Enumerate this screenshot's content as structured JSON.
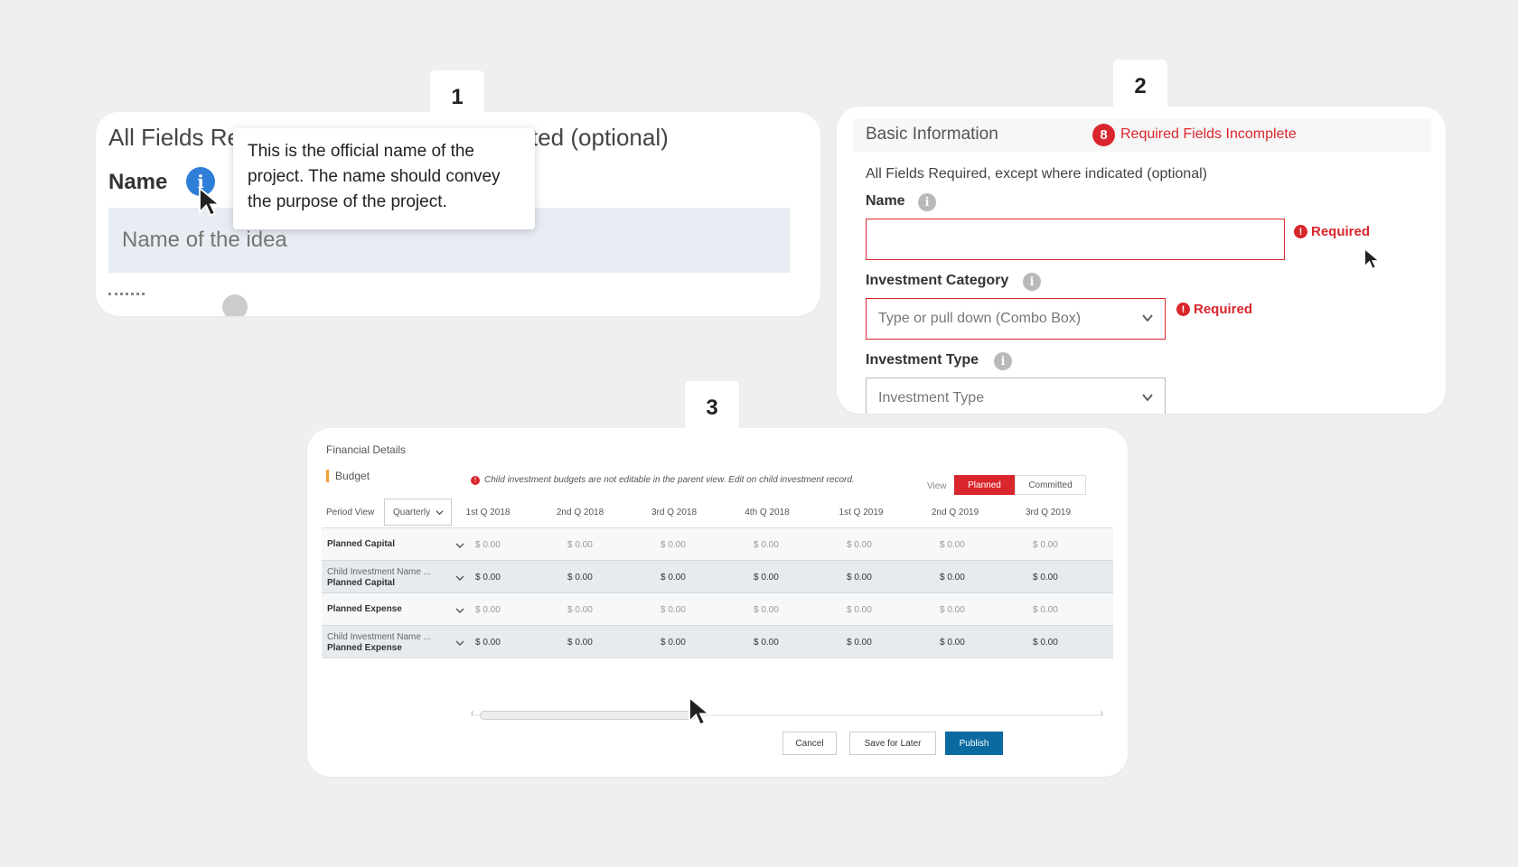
{
  "step_badges": [
    "1",
    "2",
    "3"
  ],
  "card1": {
    "heading_left": "All Fields Re",
    "heading_right": "ted (optional)",
    "name_label": "Name",
    "info_icon": "info-icon",
    "input_placeholder": "Name of the idea",
    "tooltip_lines": [
      "This is the official name of the",
      "project. The name should convey",
      "the purpose of the project."
    ]
  },
  "card2": {
    "header_title": "Basic Information",
    "error_count": "8",
    "error_text": "Required Fields Incomplete",
    "required_note": "All Fields Required, except where indicated (optional)",
    "name_label": "Name",
    "required_label": "Required",
    "investment_category_label": "Investment Category",
    "investment_category_placeholder": "Type or pull down (Combo Box)",
    "investment_type_label": "Investment Type",
    "investment_type_placeholder": "Investment Type",
    "error_color": "#d9262c"
  },
  "card3": {
    "title": "Financial Details",
    "budget_label": "Budget",
    "notice": "Child investment budgets are not editable in the parent view. Edit on child investment record.",
    "view_label": "View",
    "view_options": [
      "Planned",
      "Committed"
    ],
    "view_selected": "Planned",
    "period_view_label": "Period View",
    "period_view_value": "Quarterly",
    "columns": [
      "1st Q 2018",
      "2nd Q 2018",
      "3rd Q 2018",
      "4th Q 2018",
      "1st Q 2019",
      "2nd Q 2019",
      "3rd Q 2019"
    ],
    "rows": [
      {
        "label": "Planned Capital",
        "sub": "",
        "kind": "parent",
        "values": [
          "$ 0.00",
          "$ 0.00",
          "$ 0.00",
          "$ 0.00",
          "$ 0.00",
          "$ 0.00",
          "$ 0.00"
        ]
      },
      {
        "label": "Planned Capital",
        "sub": "Child Investment Name ...",
        "kind": "child",
        "values": [
          "$ 0.00",
          "$ 0.00",
          "$ 0.00",
          "$ 0.00",
          "$ 0.00",
          "$ 0.00",
          "$ 0.00"
        ]
      },
      {
        "label": "Planned Expense",
        "sub": "",
        "kind": "parent",
        "values": [
          "$ 0.00",
          "$ 0.00",
          "$ 0.00",
          "$ 0.00",
          "$ 0.00",
          "$ 0.00",
          "$ 0.00"
        ]
      },
      {
        "label": "Planned Expense",
        "sub": "Child Investment Name ...",
        "kind": "child",
        "values": [
          "$ 0.00",
          "$ 0.00",
          "$ 0.00",
          "$ 0.00",
          "$ 0.00",
          "$ 0.00",
          "$ 0.00"
        ]
      }
    ],
    "buttons": {
      "cancel": "Cancel",
      "save": "Save for Later",
      "publish": "Publish"
    },
    "primary_color": "#0b6aa0"
  }
}
